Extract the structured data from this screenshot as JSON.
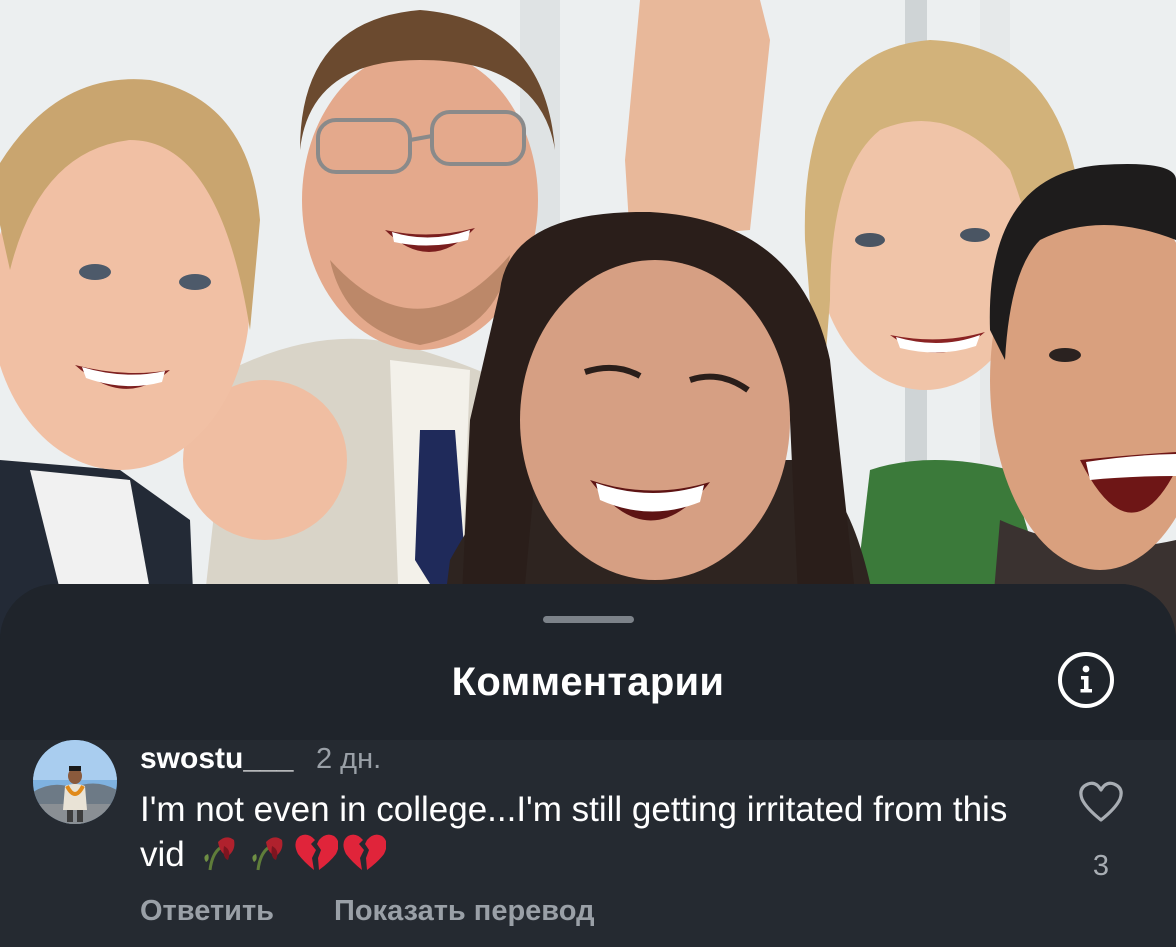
{
  "sheet": {
    "title": "Комментарии"
  },
  "comment": {
    "username": "swostu___",
    "time": "2 дн.",
    "text": "I'm not even in college...I'm still getting irritated from this vid",
    "emojis": [
      "wilted-flower",
      "wilted-flower",
      "broken-heart",
      "broken-heart"
    ],
    "likes": "3",
    "reply_label": "Ответить",
    "translate_label": "Показать перевод"
  },
  "colors": {
    "sheet_background": "#1f242b",
    "comment_background": "#252a31",
    "secondary_text": "#9aa0a7",
    "broken_heart": "#e0243a"
  },
  "icons": {
    "info": "info-circle-icon",
    "like": "heart-outline-icon"
  }
}
